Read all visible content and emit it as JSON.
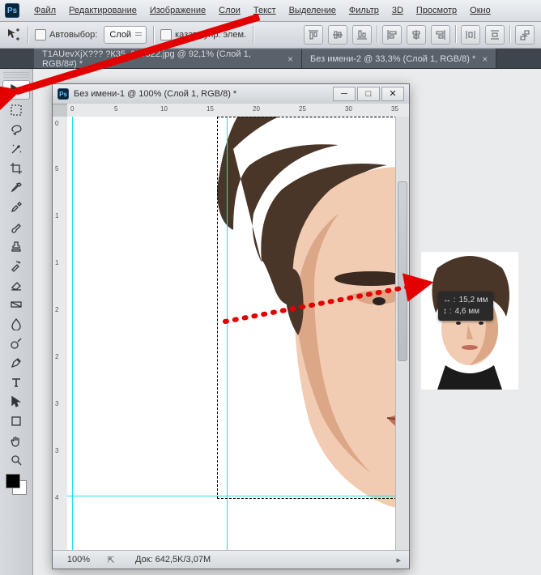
{
  "app": {
    "logo_text": "Ps"
  },
  "menu": {
    "file": "Файл",
    "edit": "Редактирование",
    "image": "Изображение",
    "layer": "Слои",
    "type": "Текст",
    "select": "Выделение",
    "filter": "Фильтр",
    "threeD": "3D",
    "view": "Просмотр",
    "window": "Окно"
  },
  "options": {
    "auto_select_label": "Автовыбор:",
    "layer_select": "Слой",
    "show_controls_label": "казать упр. элем."
  },
  "tabs": {
    "t1": "T1AUevXjX??? ?К35_055522.jpg @ 92,1% (Слой 1, RGB/8#) *",
    "t2": "Без имени-2 @ 33,3% (Слой 1, RGB/8) *"
  },
  "float_window": {
    "title": "Без имени-1 @ 100% (Слой 1, RGB/8) *",
    "ruler_h": [
      "0",
      "5",
      "10",
      "15",
      "20",
      "25",
      "30",
      "35"
    ],
    "ruler_v": [
      "0",
      "5",
      "1",
      "1",
      "2",
      "2",
      "3",
      "3",
      "4"
    ],
    "zoom": "100%",
    "docsize": "Док:   642,5K/3,07M"
  },
  "tooltip": {
    "dx_label": "↔ :",
    "dx": "15,2 мм",
    "dy_label": "↕ :",
    "dy": "4,6 мм"
  },
  "tools": [
    "move",
    "marquee",
    "lasso",
    "magic-wand",
    "crop",
    "eyedropper",
    "healing",
    "brush",
    "stamp",
    "history-brush",
    "eraser",
    "gradient",
    "blur",
    "dodge",
    "pen",
    "type",
    "path-select",
    "shape",
    "hand",
    "zoom"
  ]
}
